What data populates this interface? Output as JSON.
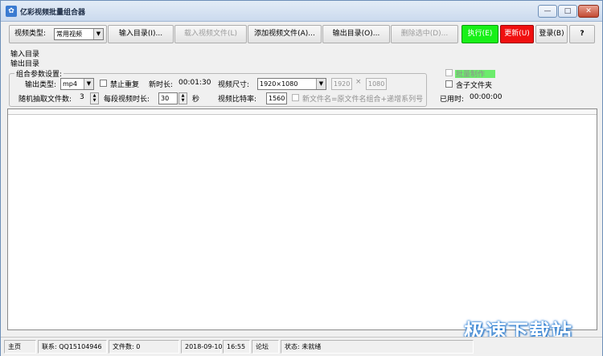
{
  "window": {
    "title": "亿彩视频批量组合器",
    "minimize_glyph": "—",
    "maximize_glyph": "□",
    "close_glyph": "✕"
  },
  "toolbar": {
    "video_type_label": "视频类型:",
    "video_type_value": "常用视频",
    "input_dir": "输入目录(I)...",
    "load_video_file": "载入视频文件(L)",
    "add_video_file": "添加视频文件(A)...",
    "output_dir": "输出目录(O)...",
    "delete_selected": "删除选中(D)...",
    "execute": "执行(E)",
    "update": "更新(U)",
    "login": "登录(B)",
    "help": "?"
  },
  "paths": {
    "input_dir_label": "输入目录",
    "output_dir_label": "输出目录"
  },
  "settings": {
    "group_title": "组合参数设置:",
    "output_type_label": "输出类型:",
    "output_type_value": "mp4",
    "no_repeat_label": "禁止重复",
    "new_duration_label": "新时长:",
    "new_duration_value": "00:01:30",
    "video_size_label": "视频尺寸:",
    "video_size_value": "1920×1080",
    "width_value": "1920",
    "times_glyph": "×",
    "height_value": "1080",
    "random_count_label": "随机抽取文件数:",
    "random_count_value": "3",
    "segment_duration_label": "每段视频时长:",
    "segment_duration_value": "30",
    "seconds_unit": "秒",
    "bitrate_label": "视频比特率:",
    "bitrate_value": "1560",
    "new_filename_label": "新文件名=原文件名组合+递增系列号",
    "batch_label": "批量制作",
    "include_subdirs_label": "含子文件夹",
    "elapsed_label": "已用时:",
    "elapsed_value": "00:00:00"
  },
  "statusbar": {
    "home": "主页",
    "contact": "联系: QQ15104946",
    "file_count": "文件数: 0",
    "date": "2018-09-10",
    "time": "16:55",
    "forum": "论坛",
    "status": "状态: 未就绪"
  },
  "watermark": "极速下载站",
  "icons": {
    "app": "app-icon",
    "dropdown": "chevron-down-icon",
    "spin": "spin-arrows-icon"
  },
  "colors": {
    "execute_bg": "#18f018",
    "update_bg": "#f01010",
    "highlight": "#6cec6c"
  }
}
